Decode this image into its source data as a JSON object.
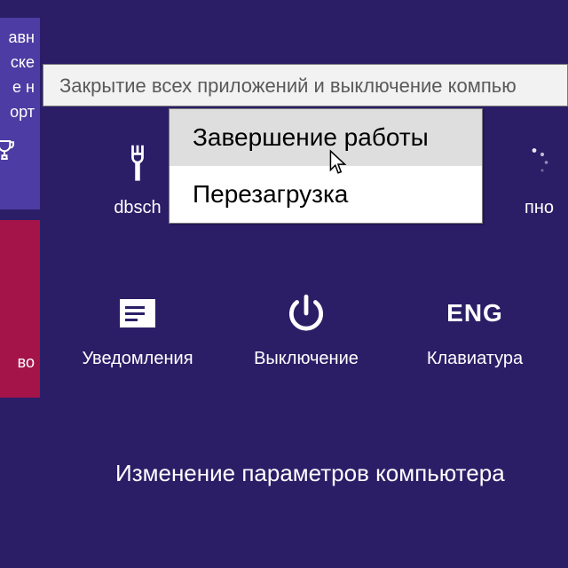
{
  "edge": {
    "line1": "авн",
    "line2": "ске",
    "line3": "е н",
    "line4": "орт",
    "crimson_text": "во"
  },
  "tooltip": "Закрытие всех приложений и выключение компью",
  "menu": {
    "items": [
      {
        "label": "Завершение работы",
        "hover": true
      },
      {
        "label": "Перезагрузка",
        "hover": false
      }
    ]
  },
  "charms_row1": [
    {
      "label": "dbsch",
      "icon": "fork"
    },
    {
      "label": "",
      "icon": ""
    },
    {
      "label": "пно",
      "icon": "loading"
    }
  ],
  "charms_row2": [
    {
      "label": "Уведомления",
      "icon": "notifications"
    },
    {
      "label": "Выключение",
      "icon": "power"
    },
    {
      "label": "Клавиатура",
      "icon": "keyboard",
      "text_icon": "ENG"
    }
  ],
  "settings_link": "Изменение параметров компьютера"
}
